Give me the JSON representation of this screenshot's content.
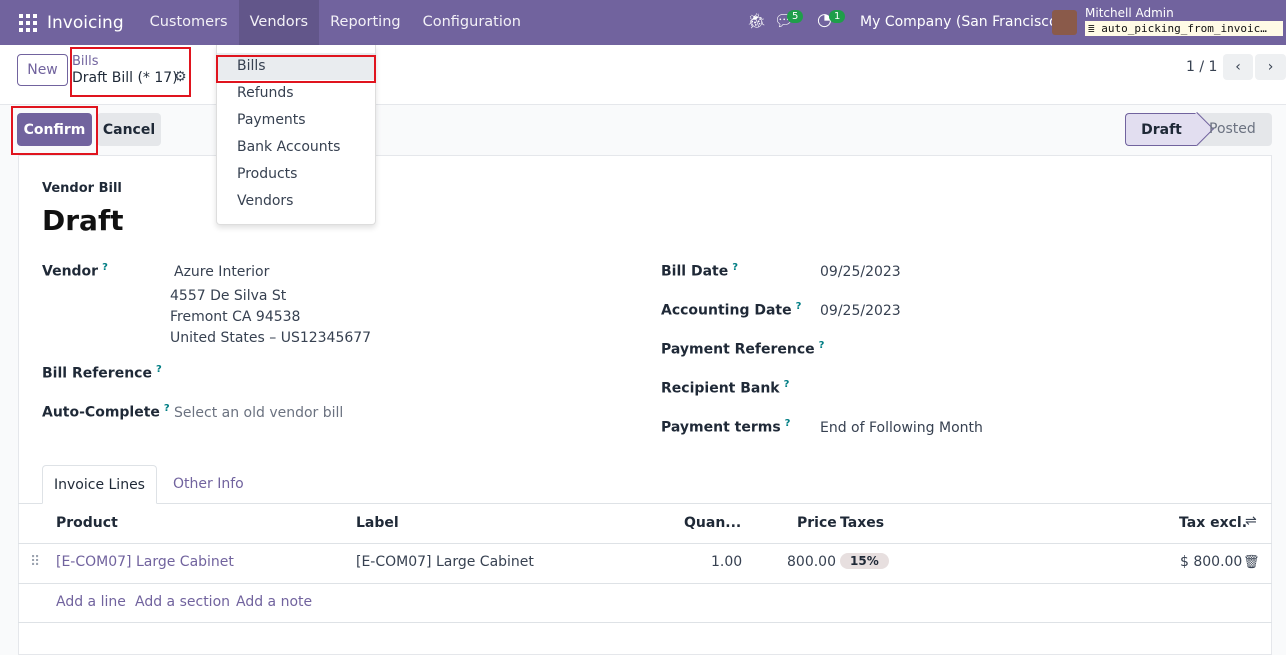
{
  "navbar": {
    "app": "Invoicing",
    "menus": [
      "Customers",
      "Vendors",
      "Reporting",
      "Configuration"
    ],
    "active_menu": "Vendors",
    "messages_count": "5",
    "activities_count": "1",
    "company": "My Company (San Francisco)",
    "user": "Mitchell Admin",
    "database": "auto_picking_from_invoic…",
    "color": "#71639e"
  },
  "control_panel": {
    "new_label": "New",
    "breadcrumb_parent": "Bills",
    "breadcrumb_current": "Draft Bill (* 17)",
    "pager": "1 / 1"
  },
  "vendors_menu": [
    "Bills",
    "Refunds",
    "Payments",
    "Bank Accounts",
    "Products",
    "Vendors"
  ],
  "actions": {
    "confirm": "Confirm",
    "cancel": "Cancel"
  },
  "status": {
    "steps": [
      "Draft",
      "Posted"
    ],
    "current": "Draft"
  },
  "form": {
    "type_label": "Vendor Bill",
    "name": "Draft",
    "vendor_label": "Vendor",
    "vendor_name": "Azure Interior",
    "vendor_address": [
      "4557 De Silva St",
      "Fremont CA 94538",
      "United States – US12345677"
    ],
    "bill_ref_label": "Bill Reference",
    "auto_complete_label": "Auto-Complete",
    "auto_complete_placeholder": "Select an old vendor bill",
    "bill_date_label": "Bill Date",
    "bill_date": "09/25/2023",
    "acc_date_label": "Accounting Date",
    "acc_date": "09/25/2023",
    "pay_ref_label": "Payment Reference",
    "recipient_bank_label": "Recipient Bank",
    "payment_terms_label": "Payment terms",
    "payment_terms": "End of Following Month",
    "help": "?"
  },
  "tabs": [
    "Invoice Lines",
    "Other Info"
  ],
  "lines": {
    "headers": [
      "Product",
      "Label",
      "Quan...",
      "Price",
      "Taxes",
      "Tax excl."
    ],
    "rows": [
      {
        "product": "[E-COM07] Large Cabinet",
        "label": "[E-COM07] Large Cabinet",
        "qty": "1.00",
        "price": "800.00",
        "tax": "15%",
        "subtotal": "$ 800.00"
      }
    ],
    "add": [
      "Add a line",
      "Add a section",
      "Add a note"
    ]
  }
}
